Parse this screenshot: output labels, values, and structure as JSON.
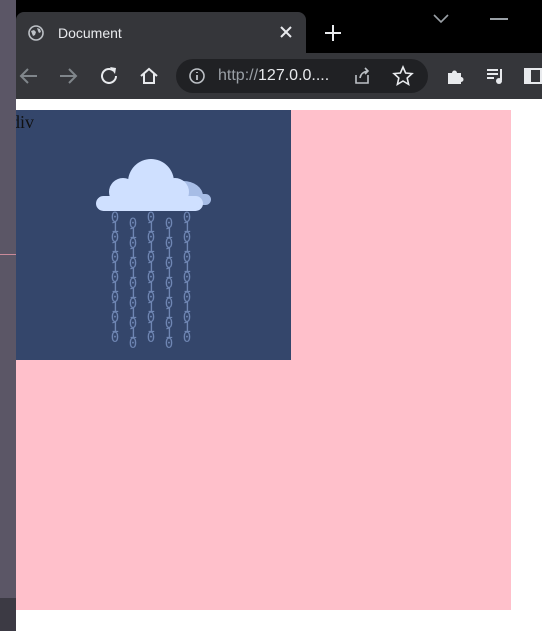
{
  "browser": {
    "tab": {
      "title": "Document",
      "favicon": "globe-icon",
      "close_icon": "close-icon"
    },
    "new_tab_icon": "plus-icon",
    "tab_search_icon": "chevron-down-icon",
    "minimize_icon": "minimize-icon",
    "toolbar": {
      "back_icon": "arrow-left-icon",
      "forward_icon": "arrow-right-icon",
      "reload_icon": "reload-icon",
      "home_icon": "home-icon",
      "extensions_icon": "puzzle-icon",
      "media_icon": "queue-music-icon",
      "side_panel_icon": "side-panel-icon"
    },
    "omnibox": {
      "scheme": "http://",
      "host": "127.0.0....",
      "info_icon": "info-icon",
      "share_icon": "share-icon",
      "bookmark_icon": "star-icon"
    }
  },
  "page": {
    "outer_background": "#ffc0cb",
    "inner_background": "#34466b",
    "inner_label": "div",
    "illustration": {
      "name": "cloud-binary-rain",
      "cloud_color": "#cfe0ff",
      "digit_color": "#6f86b3",
      "columns": [
        "0101010101010",
        "0101010101010",
        "0101010101010",
        "0101010101010",
        "0101010101010"
      ]
    }
  }
}
